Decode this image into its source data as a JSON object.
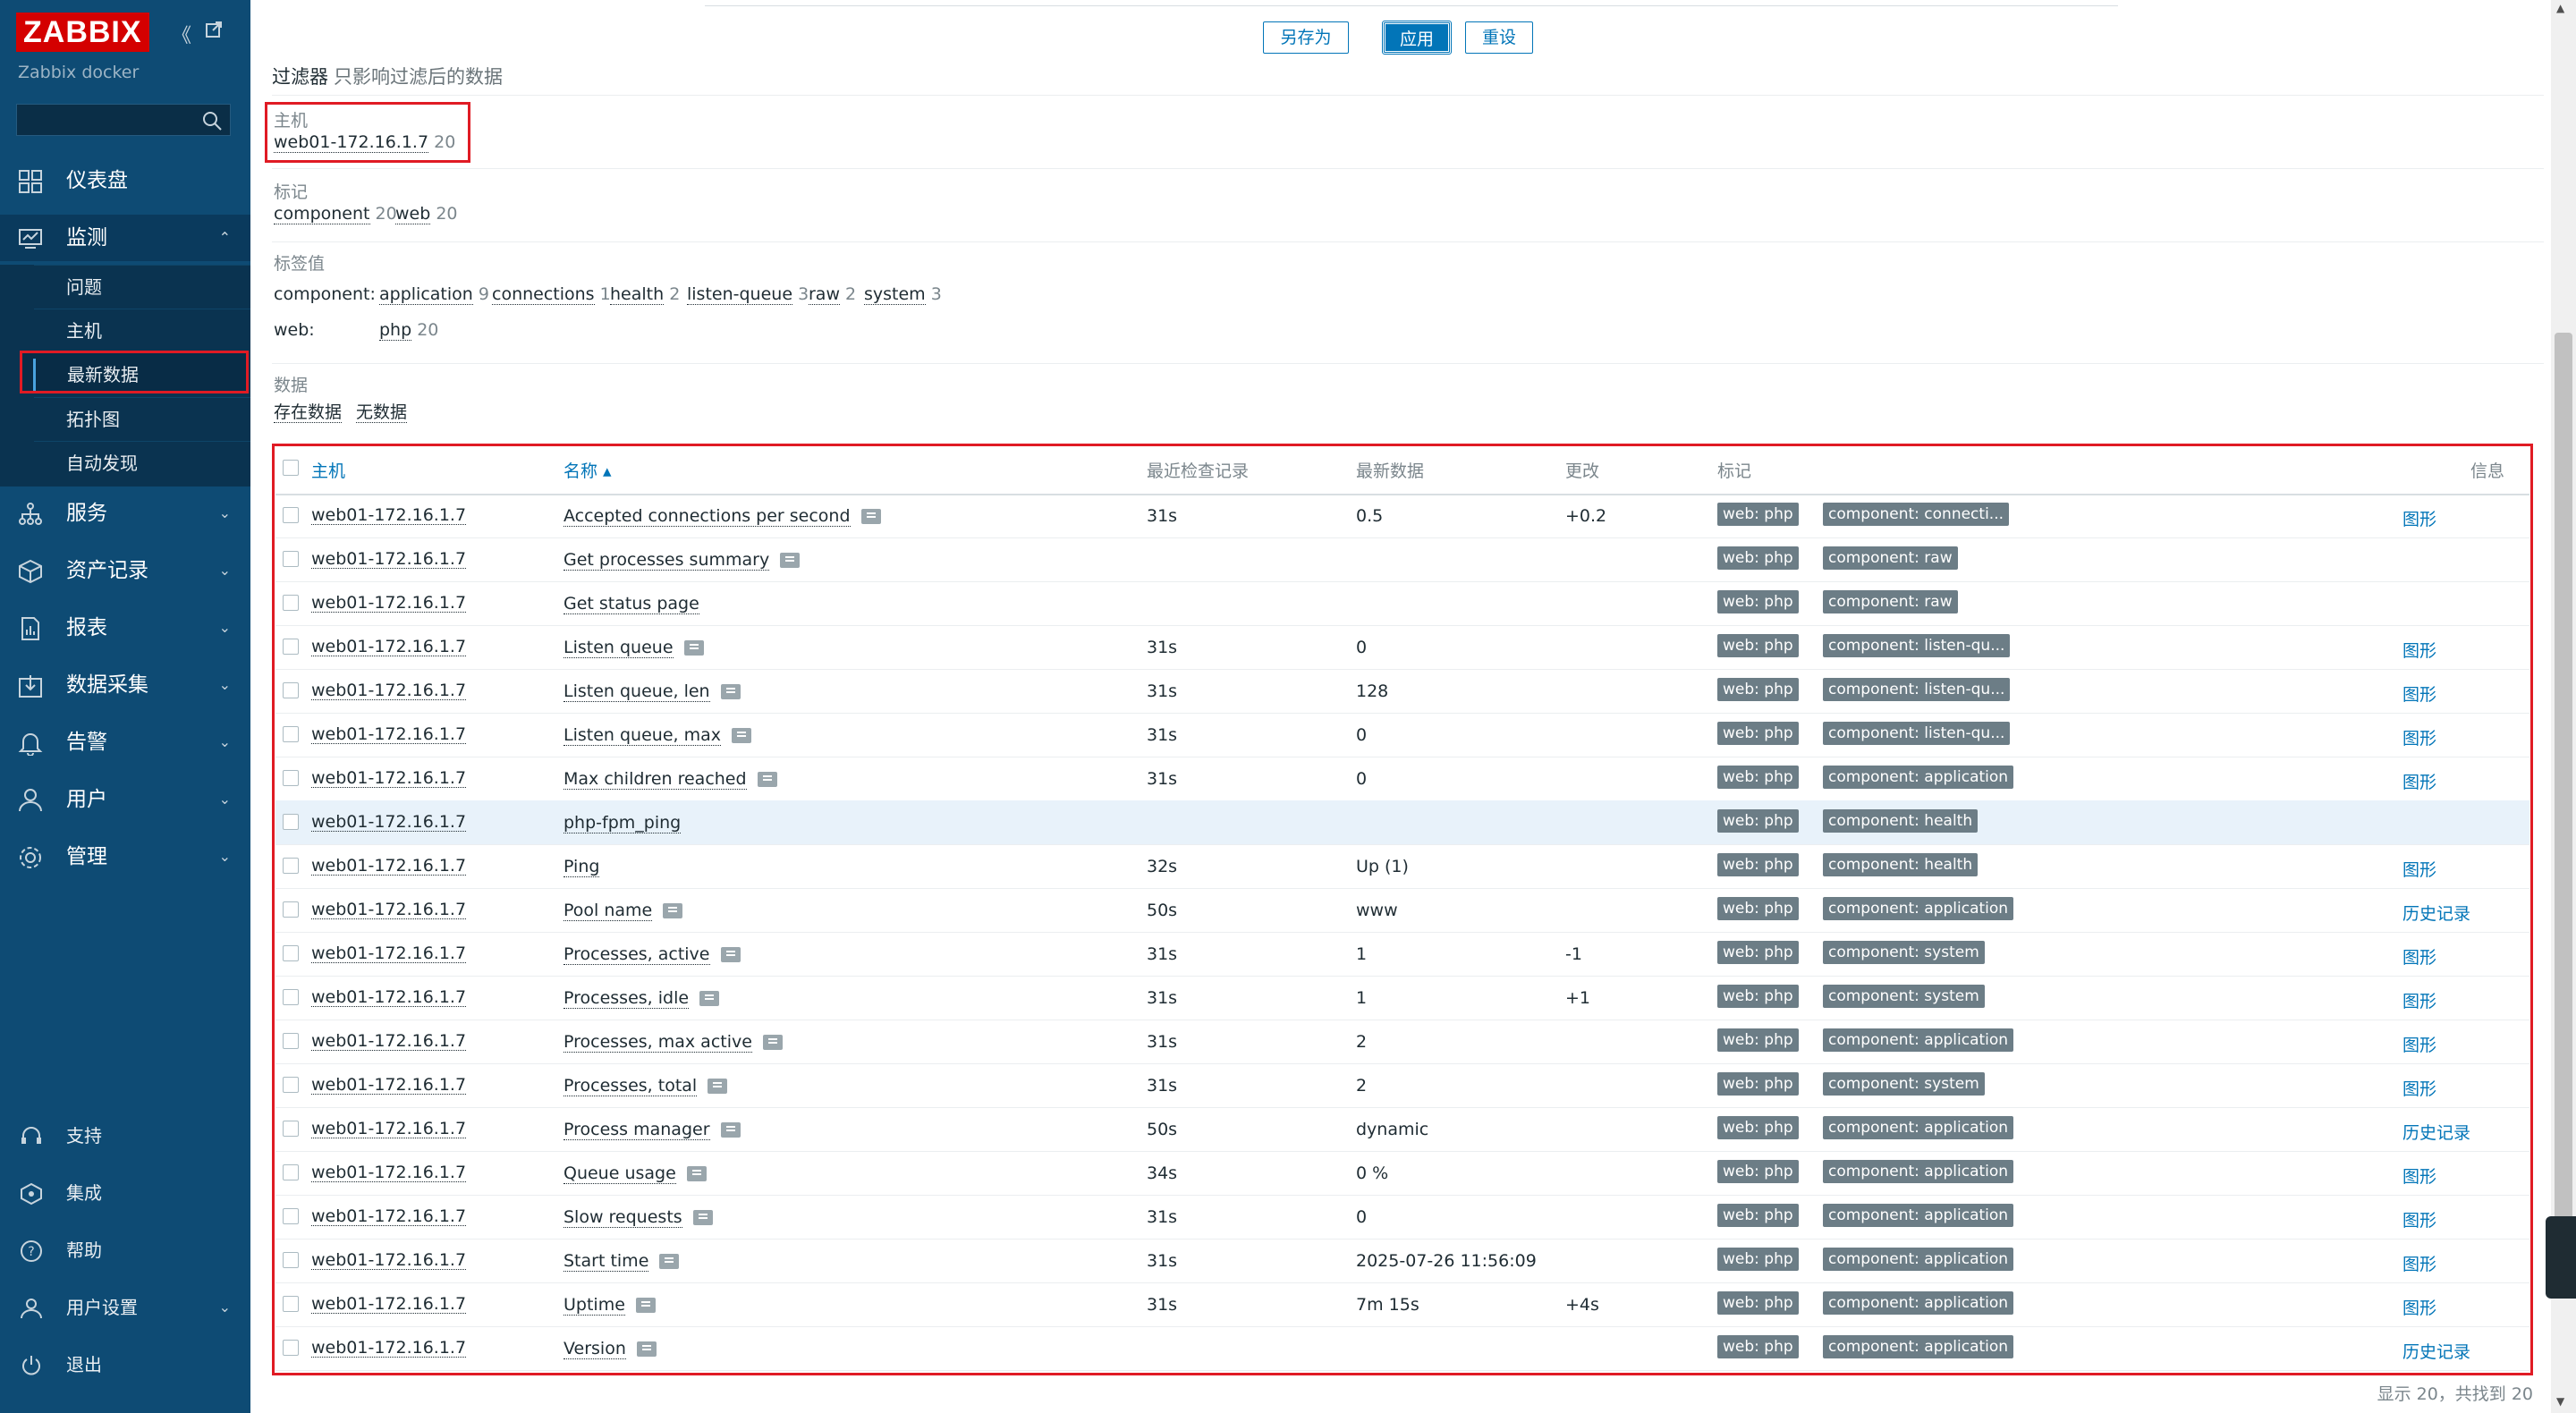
{
  "sidebar": {
    "logo": "ZABBIX",
    "subtitle": "Zabbix docker",
    "search_placeholder": "",
    "nav": [
      {
        "label": "仪表盘",
        "icon": "dashboard-icon"
      },
      {
        "label": "监测",
        "icon": "monitoring-icon"
      },
      {
        "label": "服务",
        "icon": "services-icon"
      },
      {
        "label": "资产记录",
        "icon": "inventory-icon"
      },
      {
        "label": "报表",
        "icon": "reports-icon"
      },
      {
        "label": "数据采集",
        "icon": "data-collection-icon"
      },
      {
        "label": "告警",
        "icon": "alerts-icon"
      },
      {
        "label": "用户",
        "icon": "users-icon"
      },
      {
        "label": "管理",
        "icon": "administration-icon"
      }
    ],
    "submenu": [
      "问题",
      "主机",
      "最新数据",
      "拓扑图",
      "自动发现"
    ],
    "bottom": [
      {
        "label": "支持",
        "icon": "support-icon"
      },
      {
        "label": "集成",
        "icon": "integrations-icon"
      },
      {
        "label": "帮助",
        "icon": "help-icon"
      },
      {
        "label": "用户设置",
        "icon": "user-settings-icon"
      },
      {
        "label": "退出",
        "icon": "sign-out-icon"
      }
    ]
  },
  "buttons": {
    "save_as": "另存为",
    "apply": "应用",
    "reset": "重设"
  },
  "filter": {
    "title": "过滤器",
    "subtitle": "只影响过滤后的数据",
    "host_label": "主机",
    "host_value": "web01-172.16.1.7",
    "host_count": "20",
    "tags_label": "标记",
    "tags": [
      {
        "name": "component",
        "count": "20"
      },
      {
        "name": "web",
        "count": "20"
      }
    ],
    "tag_values_label": "标签值",
    "component_key": "component:",
    "component_values": [
      {
        "name": "application",
        "count": "9"
      },
      {
        "name": "connections",
        "count": "1"
      },
      {
        "name": "health",
        "count": "2"
      },
      {
        "name": "listen-queue",
        "count": "3"
      },
      {
        "name": "raw",
        "count": "2"
      },
      {
        "name": "system",
        "count": "3"
      }
    ],
    "web_key": "web:",
    "web_values": [
      {
        "name": "php",
        "count": "20"
      }
    ],
    "data_label": "数据",
    "data_with": "存在数据",
    "data_without": "无数据"
  },
  "table": {
    "headers": {
      "host": "主机",
      "name": "名称 ▴",
      "last_check": "最近检查记录",
      "last_value": "最新数据",
      "change": "更改",
      "tags": "标记",
      "info": "信息"
    },
    "rows": [
      {
        "host": "web01-172.16.1.7",
        "name": "Accepted connections per second",
        "hint": true,
        "check": "31s",
        "value": "0.5",
        "change": "+0.2",
        "tag1": "web: php",
        "tag2": "component: connecti...",
        "info": "图形"
      },
      {
        "host": "web01-172.16.1.7",
        "name": "Get processes summary",
        "hint": true,
        "check": "",
        "value": "",
        "change": "",
        "tag1": "web: php",
        "tag2": "component: raw",
        "info": ""
      },
      {
        "host": "web01-172.16.1.7",
        "name": "Get status page",
        "hint": false,
        "check": "",
        "value": "",
        "change": "",
        "tag1": "web: php",
        "tag2": "component: raw",
        "info": ""
      },
      {
        "host": "web01-172.16.1.7",
        "name": "Listen queue",
        "hint": true,
        "check": "31s",
        "value": "0",
        "change": "",
        "tag1": "web: php",
        "tag2": "component: listen-qu...",
        "info": "图形"
      },
      {
        "host": "web01-172.16.1.7",
        "name": "Listen queue, len",
        "hint": true,
        "check": "31s",
        "value": "128",
        "change": "",
        "tag1": "web: php",
        "tag2": "component: listen-qu...",
        "info": "图形"
      },
      {
        "host": "web01-172.16.1.7",
        "name": "Listen queue, max",
        "hint": true,
        "check": "31s",
        "value": "0",
        "change": "",
        "tag1": "web: php",
        "tag2": "component: listen-qu...",
        "info": "图形"
      },
      {
        "host": "web01-172.16.1.7",
        "name": "Max children reached",
        "hint": true,
        "check": "31s",
        "value": "0",
        "change": "",
        "tag1": "web: php",
        "tag2": "component: application",
        "info": "图形"
      },
      {
        "host": "web01-172.16.1.7",
        "name": "php-fpm_ping",
        "hint": false,
        "check": "",
        "value": "",
        "change": "",
        "tag1": "web: php",
        "tag2": "component: health",
        "info": ""
      },
      {
        "host": "web01-172.16.1.7",
        "name": "Ping",
        "hint": false,
        "check": "32s",
        "value": "Up (1)",
        "change": "",
        "tag1": "web: php",
        "tag2": "component: health",
        "info": "图形"
      },
      {
        "host": "web01-172.16.1.7",
        "name": "Pool name",
        "hint": true,
        "check": "50s",
        "value": "www",
        "change": "",
        "tag1": "web: php",
        "tag2": "component: application",
        "info": "历史记录"
      },
      {
        "host": "web01-172.16.1.7",
        "name": "Processes, active",
        "hint": true,
        "check": "31s",
        "value": "1",
        "change": "-1",
        "tag1": "web: php",
        "tag2": "component: system",
        "info": "图形"
      },
      {
        "host": "web01-172.16.1.7",
        "name": "Processes, idle",
        "hint": true,
        "check": "31s",
        "value": "1",
        "change": "+1",
        "tag1": "web: php",
        "tag2": "component: system",
        "info": "图形"
      },
      {
        "host": "web01-172.16.1.7",
        "name": "Processes, max active",
        "hint": true,
        "check": "31s",
        "value": "2",
        "change": "",
        "tag1": "web: php",
        "tag2": "component: application",
        "info": "图形"
      },
      {
        "host": "web01-172.16.1.7",
        "name": "Processes, total",
        "hint": true,
        "check": "31s",
        "value": "2",
        "change": "",
        "tag1": "web: php",
        "tag2": "component: system",
        "info": "图形"
      },
      {
        "host": "web01-172.16.1.7",
        "name": "Process manager",
        "hint": true,
        "check": "50s",
        "value": "dynamic",
        "change": "",
        "tag1": "web: php",
        "tag2": "component: application",
        "info": "历史记录"
      },
      {
        "host": "web01-172.16.1.7",
        "name": "Queue usage",
        "hint": true,
        "check": "34s",
        "value": "0 %",
        "change": "",
        "tag1": "web: php",
        "tag2": "component: application",
        "info": "图形"
      },
      {
        "host": "web01-172.16.1.7",
        "name": "Slow requests",
        "hint": true,
        "check": "31s",
        "value": "0",
        "change": "",
        "tag1": "web: php",
        "tag2": "component: application",
        "info": "图形"
      },
      {
        "host": "web01-172.16.1.7",
        "name": "Start time",
        "hint": true,
        "check": "31s",
        "value": "2025-07-26 11:56:09",
        "change": "",
        "tag1": "web: php",
        "tag2": "component: application",
        "info": "图形"
      },
      {
        "host": "web01-172.16.1.7",
        "name": "Uptime",
        "hint": true,
        "check": "31s",
        "value": "7m 15s",
        "change": "+4s",
        "tag1": "web: php",
        "tag2": "component: application",
        "info": "图形"
      },
      {
        "host": "web01-172.16.1.7",
        "name": "Version",
        "hint": true,
        "check": "",
        "value": "",
        "change": "",
        "tag1": "web: php",
        "tag2": "component: application",
        "info": "历史记录"
      }
    ],
    "footer": "显示 20，共找到 20"
  },
  "colors": {
    "sidebar": "#0e4b74",
    "accent": "#0275b8",
    "highlight": "#e01b24",
    "tag": "#6c7d86"
  }
}
